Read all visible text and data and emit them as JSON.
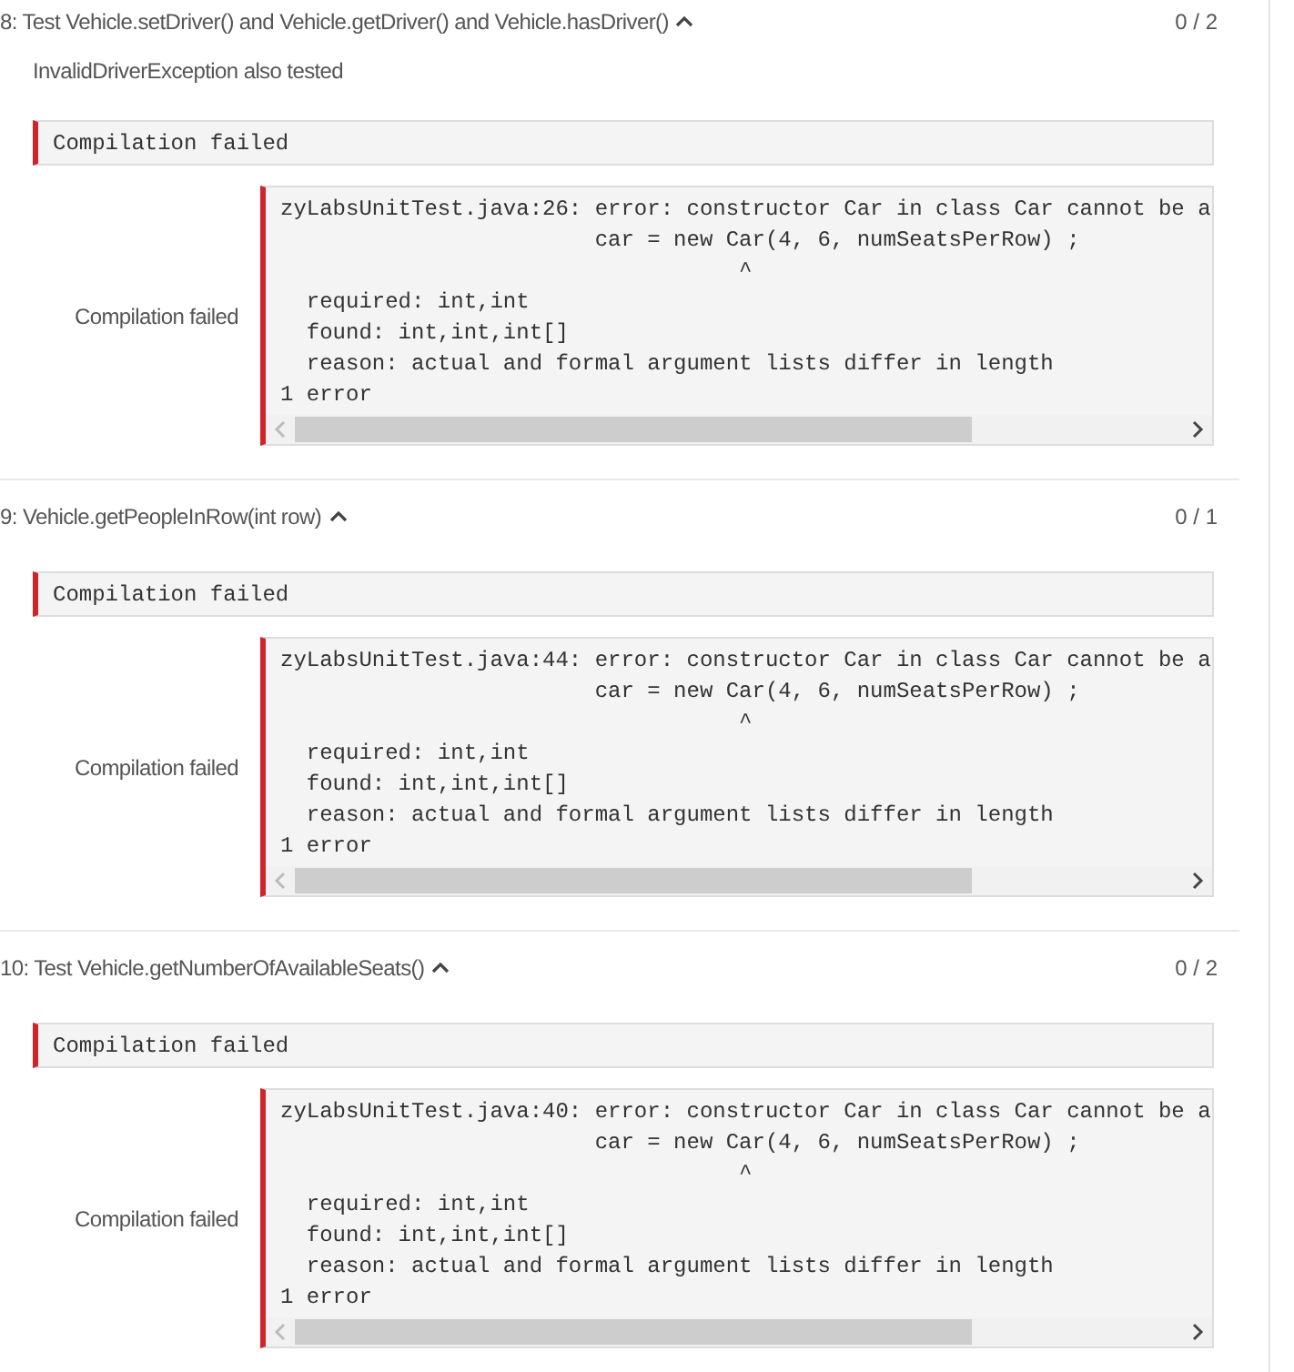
{
  "tests": [
    {
      "title": "8: Test Vehicle.setDriver() and Vehicle.getDriver() and Vehicle.hasDriver()",
      "expanded": true,
      "score": "0 / 2",
      "description": "InvalidDriverException also tested",
      "banner": "Compilation failed",
      "output_label": "Compilation failed",
      "code_lines": [
        "zyLabsUnitTest.java:26: error: constructor Car in class Car cannot be a",
        "                        car = new Car(4, 6, numSeatsPerRow) ;",
        "                                   ^",
        "  required: int,int",
        "  found: int,int,int[]",
        "  reason: actual and formal argument lists differ in length",
        "1 error"
      ]
    },
    {
      "title": "9: Vehicle.getPeopleInRow(int row)",
      "expanded": true,
      "score": "0 / 1",
      "banner": "Compilation failed",
      "output_label": "Compilation failed",
      "code_lines": [
        "zyLabsUnitTest.java:44: error: constructor Car in class Car cannot be a",
        "                        car = new Car(4, 6, numSeatsPerRow) ;",
        "                                   ^",
        "  required: int,int",
        "  found: int,int,int[]",
        "  reason: actual and formal argument lists differ in length",
        "1 error"
      ]
    },
    {
      "title": "10: Test Vehicle.getNumberOfAvailableSeats()",
      "expanded": true,
      "score": "0 / 2",
      "banner": "Compilation failed",
      "output_label": "Compilation failed",
      "code_lines": [
        "zyLabsUnitTest.java:40: error: constructor Car in class Car cannot be a",
        "                        car = new Car(4, 6, numSeatsPerRow) ;",
        "                                   ^",
        "  required: int,int",
        "  found: int,int,int[]",
        "  reason: actual and formal argument lists differ in length",
        "1 error"
      ]
    }
  ]
}
